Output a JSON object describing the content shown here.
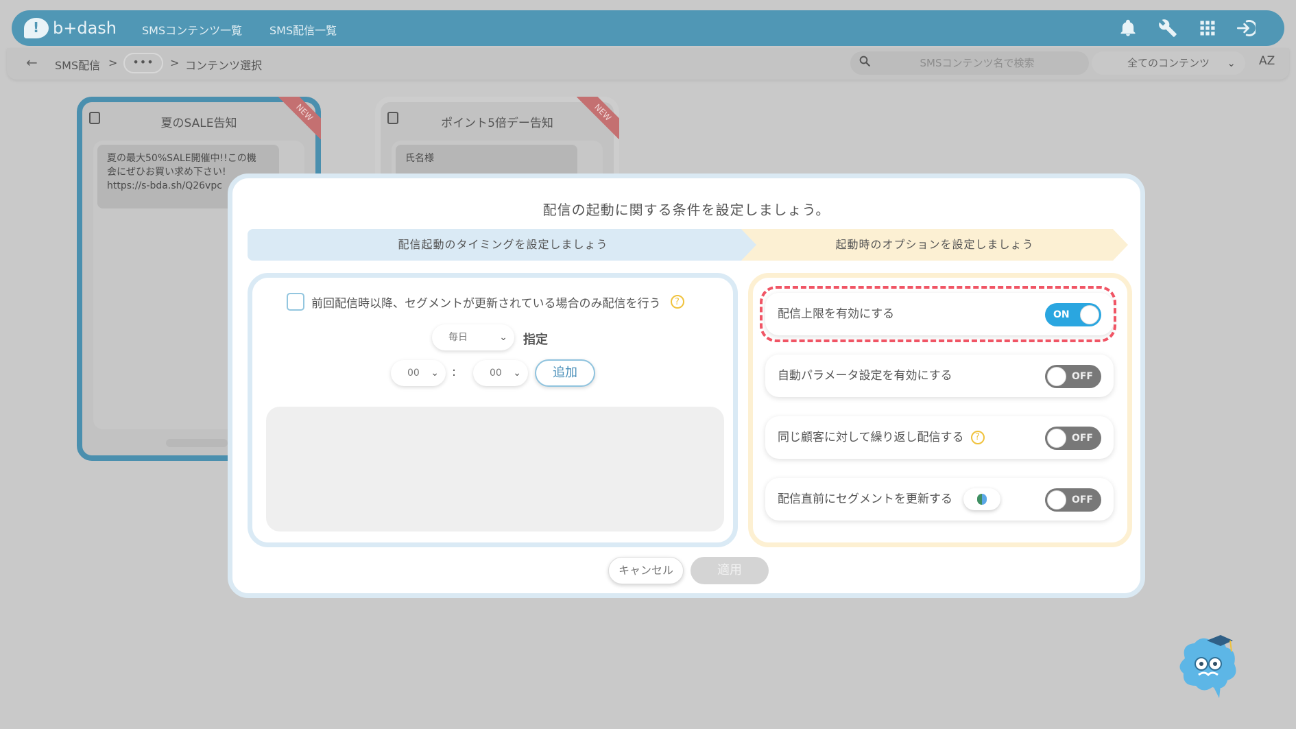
{
  "header": {
    "logo_text": "b+dash",
    "nav": [
      "SMSコンテンツ一覧",
      "SMS配信一覧"
    ]
  },
  "subbar": {
    "breadcrumb": [
      "SMS配信",
      "...",
      "コンテンツ選択"
    ],
    "separator": ">",
    "search_placeholder": "SMSコンテンツ名で検索",
    "filter_value": "全てのコンテンツ",
    "sort_label": "AZ"
  },
  "cards": [
    {
      "title": "夏のSALE告知",
      "badge": "NEW",
      "message": "夏の最大50%SALE開催中!!この機\n会にぜひお買い求め下さい!\nhttps://s-bda.sh/Q26vpc"
    },
    {
      "title": "ポイント5倍デー告知",
      "badge": "NEW",
      "message": "氏名様"
    }
  ],
  "modal": {
    "title": "配信の起動に関する条件を設定しましょう。",
    "steps": [
      "配信起動のタイミングを設定しましょう",
      "起動時のオプションを設定しましょう"
    ],
    "left": {
      "checkbox_label": "前回配信時以降、セグメントが更新されている場合のみ配信を行う",
      "frequency": "毎日",
      "specify_label": "指定",
      "hour": "00",
      "minute": "00",
      "time_sep": ":",
      "add_label": "追加"
    },
    "options": [
      {
        "label": "配信上限を有効にする",
        "state": "ON",
        "help": false
      },
      {
        "label": "自動パラメータ設定を有効にする",
        "state": "OFF",
        "help": false
      },
      {
        "label": "同じ顧客に対して繰り返し配信する",
        "state": "OFF",
        "help": true
      },
      {
        "label": "配信直前にセグメントを更新する",
        "state": "OFF",
        "help": false
      }
    ],
    "help_mark": "?",
    "cancel_label": "キャンセル",
    "apply_label": "適用"
  },
  "colors": {
    "brand": "#5097b5",
    "toggle_on": "#2aa6e0",
    "highlight": "#f05565"
  }
}
